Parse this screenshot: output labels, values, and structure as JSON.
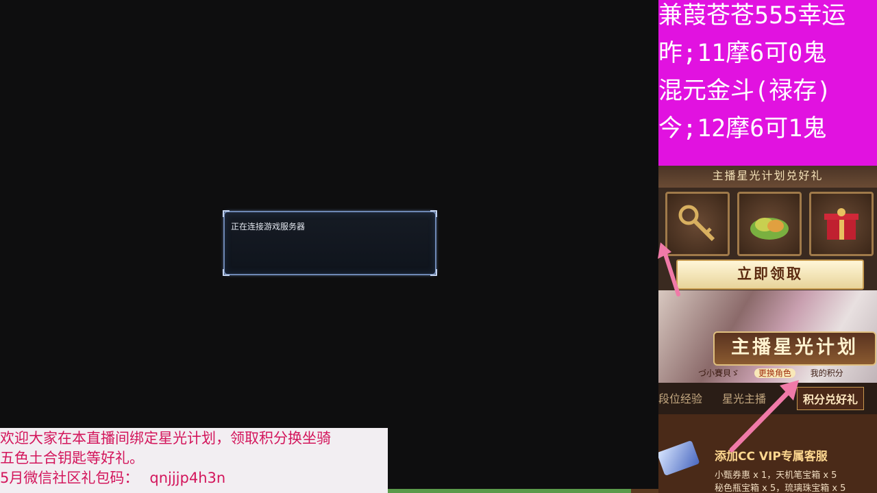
{
  "dialog": {
    "message": "正在连接游戏服务器"
  },
  "banner": {
    "line1": "欢迎大家在本直播间绑定星光计划，领取积分换坐骑",
    "line2": "五色土合钥匙等好礼。",
    "line3_label": "5月微信社区礼包码：",
    "line3_code": "qnjjjp4h3n"
  },
  "info": {
    "line1": "兼葭苍苍555幸运",
    "line2": "昨;11摩6可0鬼",
    "line3": " 混元金斗(禄存)",
    "line4": "今;12摩6可1鬼"
  },
  "panel": {
    "title": "主播星光计划兑好礼",
    "claim_label": "立即领取",
    "star_plan_title": "主播星光计划",
    "sub_items": [
      "づ小賽貝ゞ",
      "更换角色",
      "我的积分"
    ],
    "tabs": [
      "段位经验",
      "星光主播",
      "积分兑好礼"
    ],
    "vip_title": "添加CC VIP专属客服",
    "vip_line1": "小甄券惠 x 1，天机笔宝箱 x 5",
    "vip_line2": "秘色瓶宝箱 x 5，琉璃珠宝箱 x 5"
  },
  "colors": {
    "info_bg": "#e112e0",
    "banner_text": "#d3155b",
    "arrow": "#f07aa8"
  },
  "icons": [
    "key-icon",
    "jade-pile-icon",
    "gift-box-icon",
    "vip-ticket-icon"
  ]
}
